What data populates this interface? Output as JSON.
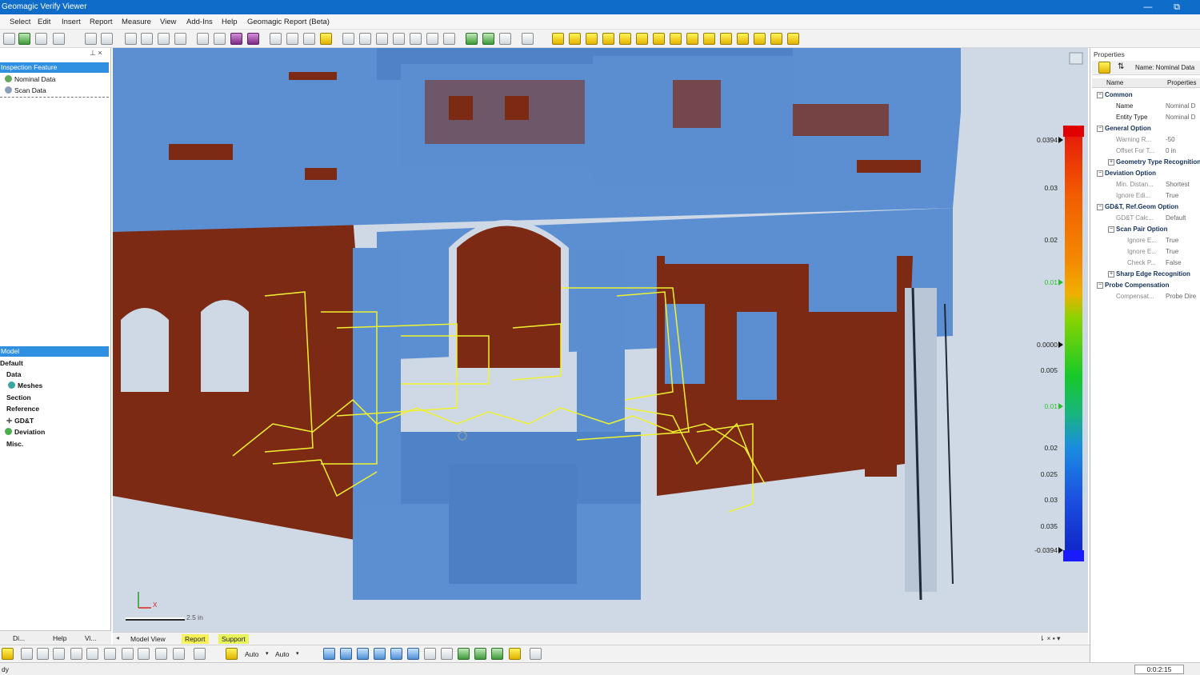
{
  "window": {
    "title": "Geomagic Verify Viewer",
    "minimize": "—",
    "restore": "⧉"
  },
  "menu": [
    "Select",
    "Edit",
    "Insert",
    "Report",
    "Measure",
    "View",
    "Add-Ins",
    "Help",
    "Geomagic Report (Beta)"
  ],
  "left_top": {
    "header": "Inspection Feature",
    "pin": "⊥ ×",
    "items": [
      "Nominal Data",
      "Scan Data"
    ]
  },
  "left_bottom": {
    "header": "Model",
    "items": [
      "Default",
      "Data",
      "Meshes",
      "Section",
      "Reference",
      "GD&T",
      "Deviation",
      "Misc."
    ]
  },
  "left_tabs": [
    "Di...",
    "Help",
    "Vi..."
  ],
  "viewport": {
    "scale_label": "2.5 in",
    "axis_x": "X",
    "colors": {
      "background": "#cfd9e6",
      "nominal": "#5b8fd2",
      "deviation_red": "#8a2a12",
      "cad_outline": "#f0f230"
    }
  },
  "color_scale": {
    "labels": [
      "0.0394",
      "0.03",
      "0.02",
      "0.01",
      "0.0000",
      "0.005",
      "0.01",
      "0.02",
      "0.025",
      "0.03",
      "0.035",
      "-0.0394"
    ],
    "values": [
      0.0394,
      0.03,
      0.02,
      0.01,
      0.0,
      -0.005,
      -0.01,
      -0.02,
      -0.025,
      -0.03,
      -0.035,
      -0.0394
    ]
  },
  "view_tabs": [
    "Model View",
    "Report",
    "Support"
  ],
  "view_tab_controls": "⇂ × ▪ ▾",
  "bottom_bar": {
    "auto1": "Auto",
    "auto2": "Auto"
  },
  "status": {
    "left": "dy",
    "time": "0:0:2:15"
  },
  "properties": {
    "title": "Properties",
    "name_field": "Name: Nominal Data",
    "col_name": "Name",
    "col_props": "Properties",
    "rows": [
      {
        "type": "cat",
        "key": "Common",
        "value": ""
      },
      {
        "type": "row",
        "key": "Name",
        "value": "Nominal D"
      },
      {
        "type": "row",
        "key": "Entity Type",
        "value": "Nominal D"
      },
      {
        "type": "cat",
        "key": "General Option",
        "value": ""
      },
      {
        "type": "muted",
        "key": "Warning R...",
        "value": "-50"
      },
      {
        "type": "muted",
        "key": "Offset For T...",
        "value": "0 in"
      },
      {
        "type": "sub",
        "key": "Geometry Type Recognition",
        "value": ""
      },
      {
        "type": "cat",
        "key": "Deviation Option",
        "value": ""
      },
      {
        "type": "muted",
        "key": "Min. Distan...",
        "value": "Shortest"
      },
      {
        "type": "muted",
        "key": "Ignore Edi...",
        "value": "True"
      },
      {
        "type": "cat",
        "key": "GD&T, Ref.Geom Option",
        "value": ""
      },
      {
        "type": "muted",
        "key": "GD&T Calc...",
        "value": "Default"
      },
      {
        "type": "sub",
        "key": "Scan Pair Option",
        "value": ""
      },
      {
        "type": "muted2",
        "key": "Ignore E...",
        "value": "True"
      },
      {
        "type": "muted2",
        "key": "Ignore E...",
        "value": "True"
      },
      {
        "type": "muted2",
        "key": "Check P...",
        "value": "False"
      },
      {
        "type": "sub",
        "key": "Sharp Edge Recognition",
        "value": ""
      },
      {
        "type": "cat",
        "key": "Probe Compensation",
        "value": ""
      },
      {
        "type": "muted",
        "key": "Compensat...",
        "value": "Probe Dire"
      }
    ]
  }
}
